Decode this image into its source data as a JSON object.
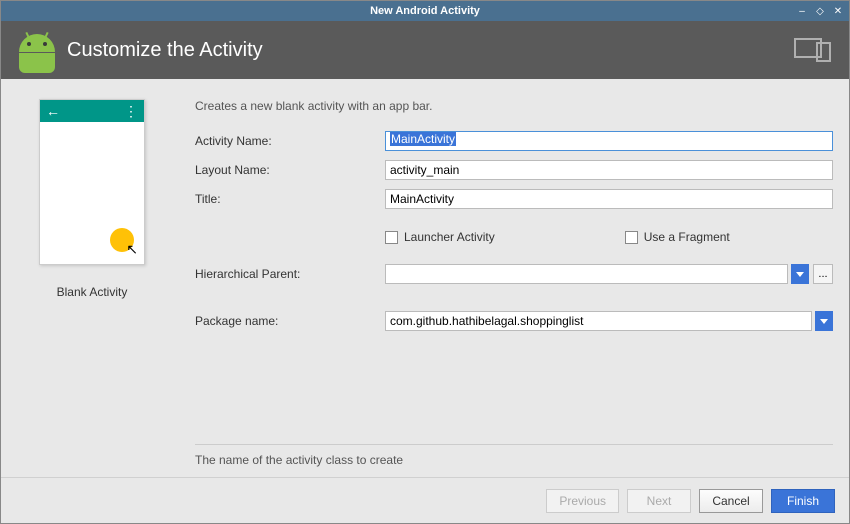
{
  "window": {
    "title": "New Android Activity"
  },
  "banner": {
    "title": "Customize the Activity"
  },
  "preview": {
    "label": "Blank Activity"
  },
  "form": {
    "description": "Creates a new blank activity with an app bar.",
    "activity_name": {
      "label": "Activity Name:",
      "value": "MainActivity"
    },
    "layout_name": {
      "label": "Layout Name:",
      "value": "activity_main"
    },
    "title_field": {
      "label": "Title:",
      "value": "MainActivity"
    },
    "launcher": {
      "label": "Launcher Activity"
    },
    "fragment": {
      "label": "Use a Fragment"
    },
    "parent": {
      "label": "Hierarchical Parent:",
      "value": ""
    },
    "package": {
      "label": "Package name:",
      "value": "com.github.hathibelagal.shoppinglist"
    },
    "ellipsis": "..."
  },
  "help": {
    "text": "The name of the activity class to create"
  },
  "footer": {
    "previous": "Previous",
    "next": "Next",
    "cancel": "Cancel",
    "finish": "Finish"
  }
}
